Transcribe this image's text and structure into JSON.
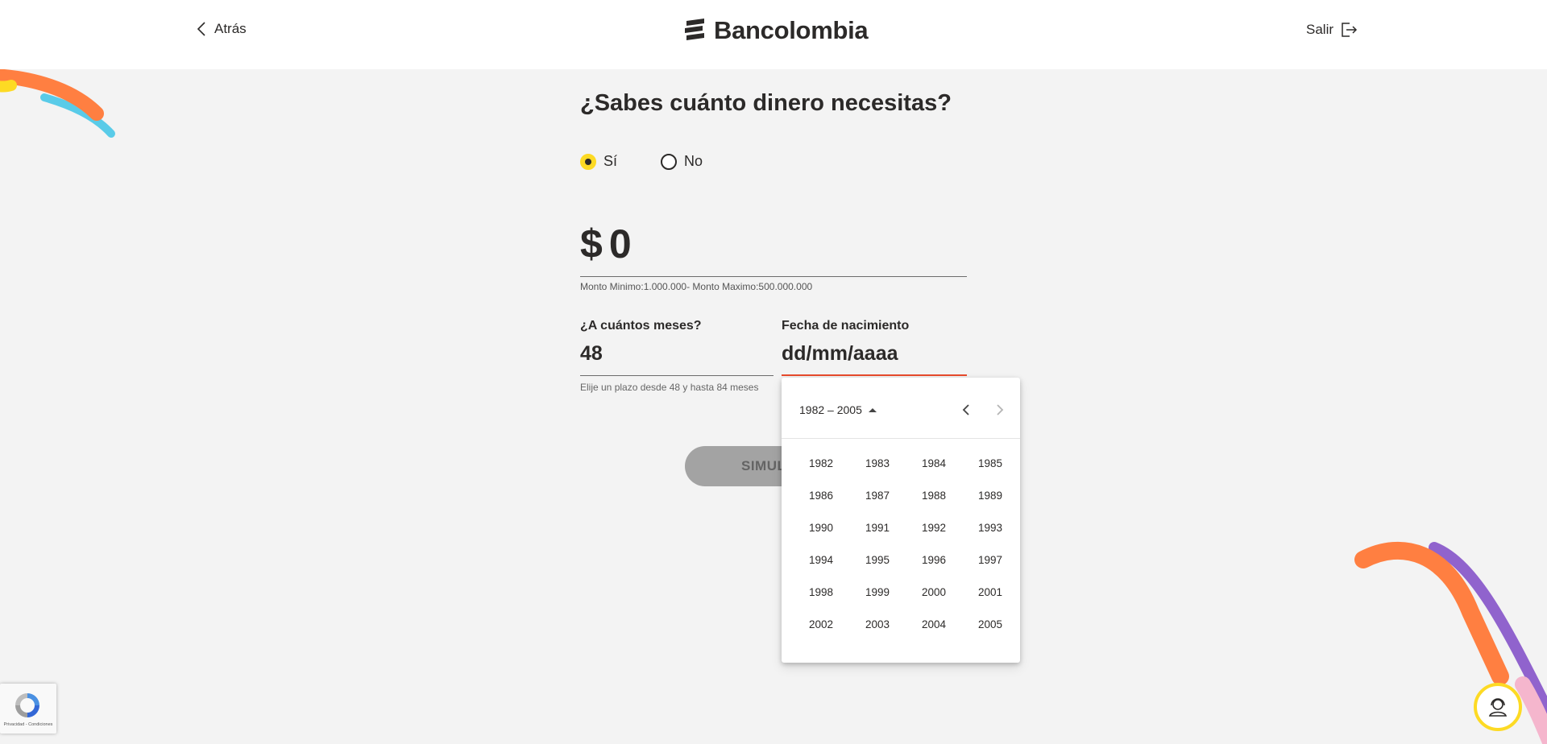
{
  "header": {
    "back_label": "Atrás",
    "brand": "Bancolombia",
    "exit_label": "Salir"
  },
  "form": {
    "title": "¿Sabes cuánto dinero necesitas?",
    "options": [
      {
        "label": "Sí",
        "selected": true
      },
      {
        "label": "No",
        "selected": false
      }
    ],
    "amount": {
      "currency": "$",
      "value": "0",
      "hint": "Monto Minimo:1.000.000- Monto Maximo:500.000.000"
    },
    "months": {
      "label": "¿A cuántos meses?",
      "value": "48",
      "hint": "Elije un plazo desde 48 y hasta 84 meses"
    },
    "birthdate": {
      "label": "Fecha de nacimiento",
      "placeholder": "dd/mm/aaaa"
    },
    "simulate_label": "SIMULAR"
  },
  "datepicker": {
    "period_label": "1982 – 2005",
    "years": [
      "1982",
      "1983",
      "1984",
      "1985",
      "1986",
      "1987",
      "1988",
      "1989",
      "1990",
      "1991",
      "1992",
      "1993",
      "1994",
      "1995",
      "1996",
      "1997",
      "1998",
      "1999",
      "2000",
      "2001",
      "2002",
      "2003",
      "2004",
      "2005"
    ]
  },
  "recaptcha": {
    "text": "Privacidad - Condiciones"
  },
  "colors": {
    "brand_yellow": "#fdda24",
    "error_orange": "#e84b2d",
    "background": "#f3f3f3",
    "button_disabled": "#a3a3a3"
  },
  "icons": {
    "back": "chevron-left-icon",
    "exit": "logout-icon",
    "help": "assistant-icon"
  }
}
